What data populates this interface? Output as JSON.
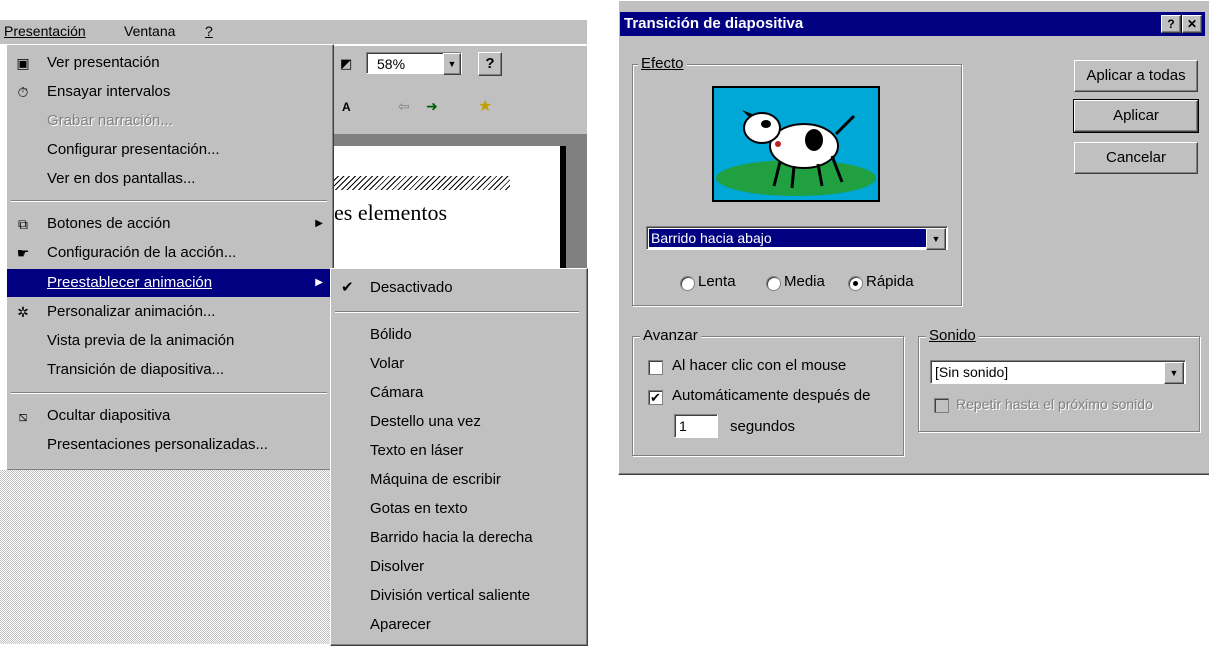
{
  "menubar": {
    "items": [
      "Presentación",
      "Ventana",
      "?"
    ]
  },
  "menu": {
    "items": [
      {
        "label": "Ver presentación",
        "icon": "slideshow-icon",
        "disabled": false
      },
      {
        "label": "Ensayar intervalos",
        "icon": "timer-icon",
        "disabled": false
      },
      {
        "label": "Grabar narración...",
        "icon": "",
        "disabled": true
      },
      {
        "label": "Configurar presentación...",
        "icon": "",
        "disabled": false
      },
      {
        "label": "Ver en dos pantallas...",
        "icon": "",
        "disabled": false
      },
      {
        "label": "Botones de acción",
        "icon": "action-buttons-icon",
        "disabled": false
      },
      {
        "label": "Configuración de la acción...",
        "icon": "action-settings-icon",
        "disabled": false
      },
      {
        "label": "Preestablecer animación",
        "icon": "",
        "disabled": false
      },
      {
        "label": "Personalizar animación...",
        "icon": "custom-animation-icon",
        "disabled": false
      },
      {
        "label": "Vista previa de la animación",
        "icon": "",
        "disabled": false
      },
      {
        "label": "Transición de diapositiva...",
        "icon": "",
        "disabled": false
      },
      {
        "label": "Ocultar diapositiva",
        "icon": "hide-slide-icon",
        "disabled": false
      },
      {
        "label": "Presentaciones personalizadas...",
        "icon": "",
        "disabled": false
      }
    ]
  },
  "submenu": {
    "checked_item": "Desactivado",
    "items": [
      "Bólido",
      "Volar",
      "Cámara",
      "Destello una vez",
      "Texto en láser",
      "Máquina de escribir",
      "Gotas en texto",
      "Barrido hacia la derecha",
      "Disolver",
      "División vertical saliente",
      "Aparecer"
    ]
  },
  "toolbar": {
    "zoom": "58%"
  },
  "slide": {
    "title_text": "es elementos"
  },
  "dialog": {
    "title": "Transición de diapositiva",
    "help_btn": "?",
    "close_btn": "✕",
    "effect_group": "Efecto",
    "effect_value": "Barrido hacia abajo",
    "speeds": [
      "Lenta",
      "Media",
      "Rápida"
    ],
    "speed_selected": "Rápida",
    "buttons": [
      "Aplicar a todas",
      "Aplicar",
      "Cancelar"
    ],
    "advance_group": "Avanzar",
    "advance_on_click": "Al hacer clic con el mouse",
    "advance_auto": "Automáticamente después de",
    "advance_seconds": "1",
    "seconds_label": "segundos",
    "sound_group": "Sonido",
    "sound_value": "[Sin sonido]",
    "loop_sound": "Repetir hasta el próximo sonido"
  },
  "colors": {
    "menu_bg": "#c0c0c0",
    "highlight": "#000080",
    "title_bar": "#000080"
  }
}
